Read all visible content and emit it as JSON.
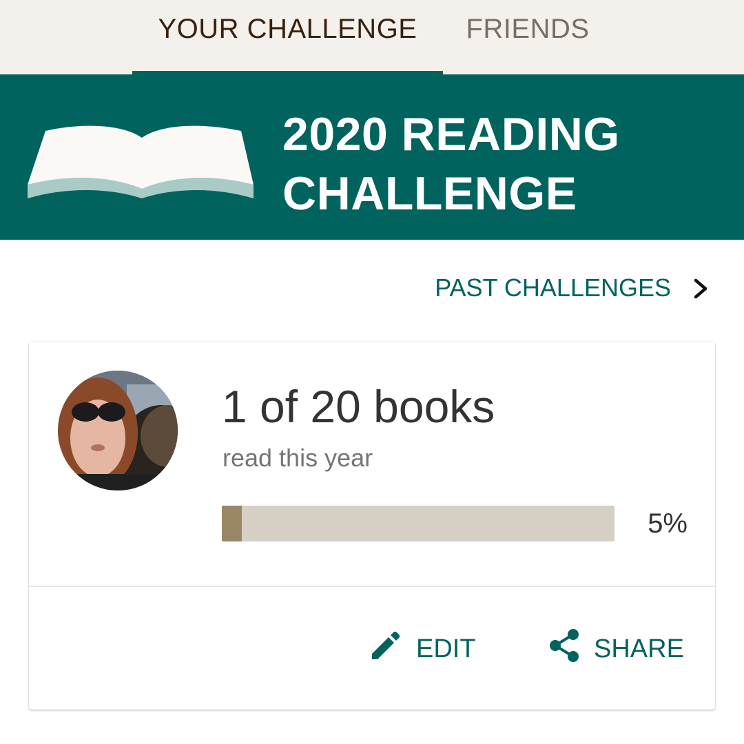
{
  "tabs": {
    "active": "YOUR CHALLENGE",
    "inactive": "FRIENDS"
  },
  "banner": {
    "title_line1": "2020 READING",
    "title_line2": "CHALLENGE",
    "icon": "open-book-icon"
  },
  "past_challenges": {
    "label": "PAST CHALLENGES",
    "icon": "chevron-right-icon"
  },
  "card": {
    "books_text": "1 of 20 books",
    "subtitle": "read this year",
    "progress_fraction": 0.05,
    "progress_label": "5%",
    "avatar": "user-avatar-photo",
    "actions": {
      "edit": {
        "label": "EDIT",
        "icon": "pencil-icon"
      },
      "share": {
        "label": "SHARE",
        "icon": "share-icon"
      }
    }
  },
  "colors": {
    "accent_green": "#00635d",
    "tab_background": "#f4f1ec",
    "progress_fill": "#9a8766",
    "progress_track": "#d6d0c4"
  }
}
